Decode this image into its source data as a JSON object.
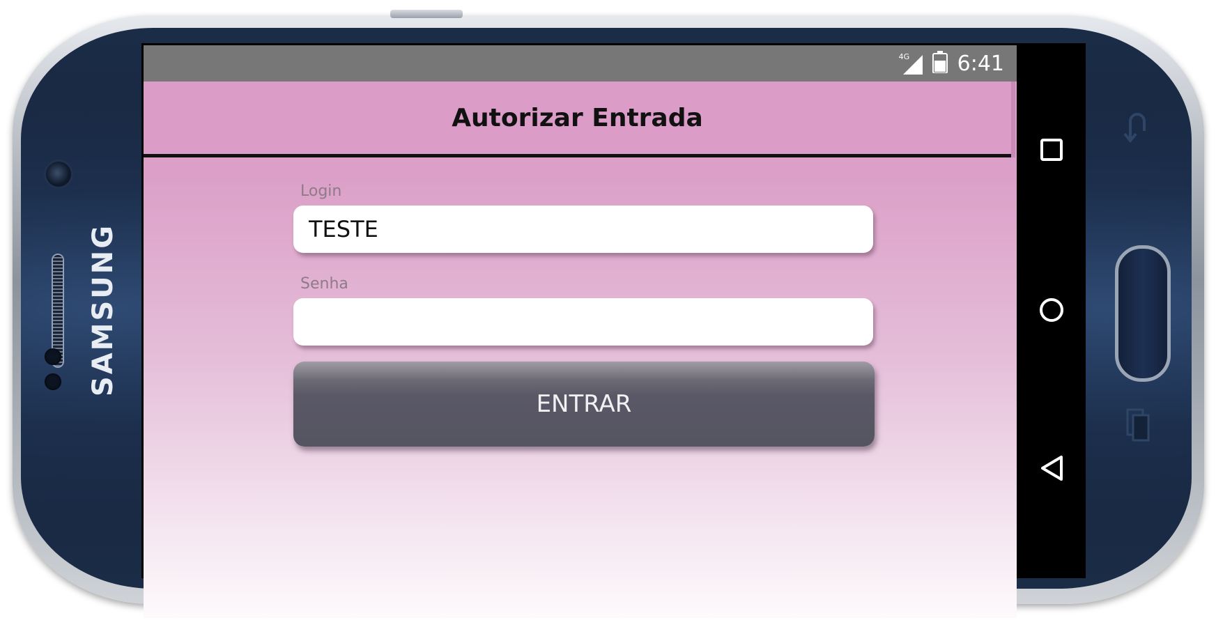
{
  "status_bar": {
    "network_label": "4G",
    "time": "6:41",
    "signal_icon": "signal-icon",
    "battery_icon": "battery-icon"
  },
  "phone": {
    "brand": "SAMSUNG"
  },
  "app": {
    "title": "Autorizar Entrada",
    "login": {
      "label": "Login",
      "value": "TESTE"
    },
    "password": {
      "label": "Senha",
      "value": ""
    },
    "submit_label": "ENTRAR"
  },
  "navigation": {
    "recents_icon": "square-recents-icon",
    "home_icon": "circle-home-icon",
    "back_icon": "triangle-back-icon"
  },
  "colors": {
    "app_bar": "#dc9cc8",
    "status_bar": "#777777",
    "button": "#555461"
  }
}
